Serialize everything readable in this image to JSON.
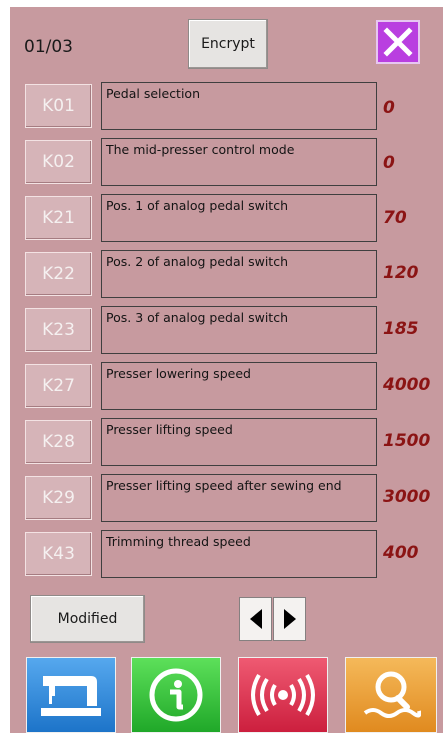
{
  "header": {
    "page_indicator": "01/03",
    "encrypt_label": "Encrypt"
  },
  "params": [
    {
      "code": "K01",
      "desc": "Pedal selection",
      "value": "0"
    },
    {
      "code": "K02",
      "desc": "The mid-presser control mode",
      "value": "0"
    },
    {
      "code": "K21",
      "desc": "Pos. 1 of analog pedal switch",
      "value": "70"
    },
    {
      "code": "K22",
      "desc": "Pos. 2 of analog pedal switch",
      "value": "120"
    },
    {
      "code": "K23",
      "desc": "Pos. 3 of analog pedal switch",
      "value": "185"
    },
    {
      "code": "K27",
      "desc": "Presser lowering speed",
      "value": "4000"
    },
    {
      "code": "K28",
      "desc": "Presser lifting speed",
      "value": "1500"
    },
    {
      "code": "K29",
      "desc": "Presser lifting speed after sewing end",
      "value": "3000"
    },
    {
      "code": "K43",
      "desc": "Trimming thread speed",
      "value": "400"
    }
  ],
  "footer": {
    "modified_label": "Modified"
  },
  "bottom_nav": [
    {
      "icon": "sewing-machine-icon",
      "color": "#2f8fe0"
    },
    {
      "icon": "info-icon",
      "color": "#33c43a"
    },
    {
      "icon": "signal-icon",
      "color": "#e03352"
    },
    {
      "icon": "search-icon",
      "color": "#f0a23a"
    }
  ],
  "colors": {
    "background": "#c79a9f",
    "value_text": "#8b1414",
    "close_button": "#b93fe0"
  }
}
